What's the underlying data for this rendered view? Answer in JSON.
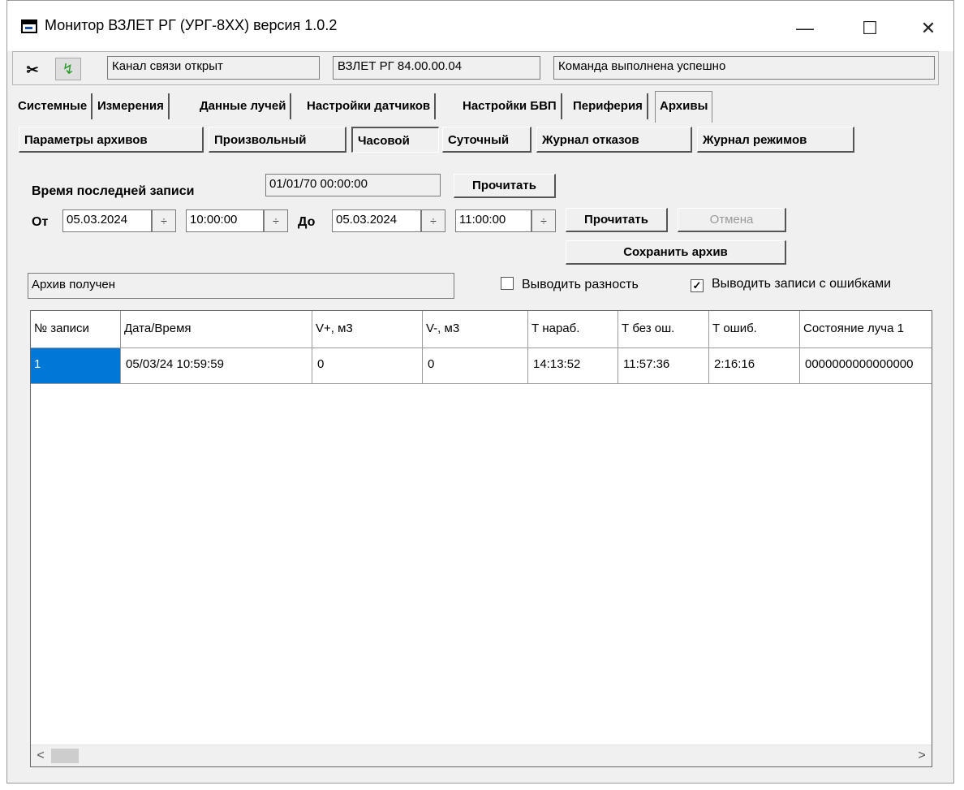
{
  "window": {
    "title": "Монитор ВЗЛЕТ РГ (УРГ-8XX) версия 1.0.2",
    "controls": {
      "minimize": "—",
      "maximize": "☐",
      "close": "✕"
    }
  },
  "statusbar": {
    "disconnect_icon": "✂",
    "connect_icon": "↯",
    "channel_status": "Канал связи открыт",
    "device_version": "ВЗЛЕТ РГ 84.00.00.04",
    "command_status": "Команда выполнена успешно"
  },
  "main_tabs": [
    "Системные",
    "Измерения",
    "Данные лучей",
    "Настройки датчиков",
    "Настройки БВП",
    "Периферия",
    "Архивы"
  ],
  "archive_tabs": [
    "Параметры архивов",
    "Произвольный",
    "Часовой",
    "Суточный",
    "Журнал отказов",
    "Журнал режимов"
  ],
  "last_record": {
    "label": "Время последней записи",
    "value": "01/01/70 00:00:00",
    "read_button": "Прочитать"
  },
  "range": {
    "from_label": "От",
    "from_date": "05.03.2024",
    "from_time": "10:00:00",
    "to_label": "До",
    "to_date": "05.03.2024",
    "to_time": "11:00:00",
    "read_button": "Прочитать",
    "cancel_button": "Отмена",
    "save_button": "Сохранить архив",
    "spin_glyph": "÷"
  },
  "archive_status": "Архив получен",
  "options": {
    "show_difference": {
      "label": "Выводить разность",
      "checked": false
    },
    "show_error_records": {
      "label": "Выводить записи с ошибками",
      "checked": true,
      "mark": "✓"
    }
  },
  "table": {
    "columns": [
      "№ записи",
      "Дата/Время",
      "V+, м3",
      "V-, м3",
      "Т нараб.",
      "Т без ош.",
      "Т ошиб.",
      "Состояние луча 1"
    ],
    "rows": [
      [
        "1",
        "05/03/24 10:59:59",
        "0",
        "0",
        "14:13:52",
        "11:57:36",
        "2:16:16",
        "0000000000000000"
      ]
    ],
    "scroll_left": "<",
    "scroll_right": ">"
  },
  "colors": {
    "selection": "#0078d7",
    "window_bg": "#f0f0f0"
  }
}
